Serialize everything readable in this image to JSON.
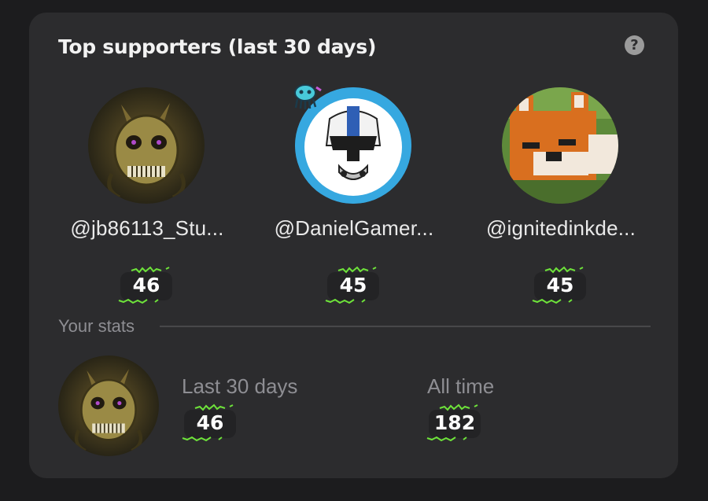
{
  "card": {
    "title": "Top supporters (last 30 days)",
    "help_icon": "question-mark-icon"
  },
  "supporters": [
    {
      "handle": "@jb86113_Stu...",
      "count": "46",
      "avatar": "springtrap-avatar"
    },
    {
      "handle": "@DanielGamer...",
      "count": "45",
      "avatar": "clone-trooper-avatar"
    },
    {
      "handle": "@ignitedinkde...",
      "count": "45",
      "avatar": "minecraft-fox-avatar"
    }
  ],
  "your_stats": {
    "section_label": "Your stats",
    "last_30_label": "Last 30 days",
    "last_30_value": "46",
    "all_time_label": "All time",
    "all_time_value": "182"
  },
  "colors": {
    "background": "#1c1c1e",
    "card": "#2c2c2e",
    "badge": "#232325",
    "sprig": "#6ee33a"
  }
}
